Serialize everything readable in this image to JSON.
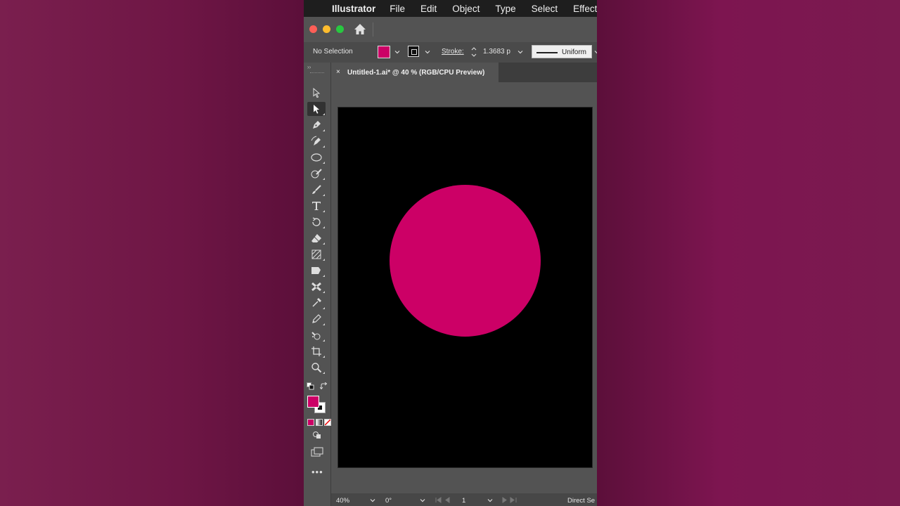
{
  "menubar": {
    "app_name": "Illustrator",
    "items": [
      "File",
      "Edit",
      "Object",
      "Type",
      "Select",
      "Effect"
    ]
  },
  "controlbar": {
    "selection_status": "No Selection",
    "stroke_label": "Stroke:",
    "stroke_weight": "1.3683 p",
    "profile": "Uniform",
    "fill_color": "#cc0066"
  },
  "document": {
    "tab_title": "Untitled-1.ai* @ 40 % (RGB/CPU Preview)",
    "close_glyph": "×",
    "artboard_color": "#000000",
    "circle_color": "#cc0066"
  },
  "tools": {
    "collapse_glyph": "››",
    "more_glyph": "•••"
  },
  "statusbar": {
    "zoom": "40%",
    "rotation": "0°",
    "artboard_number": "1",
    "current_tool": "Direct Se"
  }
}
